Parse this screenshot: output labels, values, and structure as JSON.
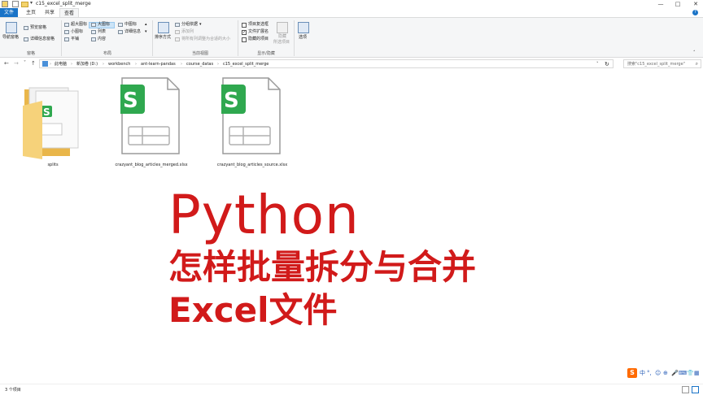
{
  "window": {
    "title": "c15_excel_split_merge",
    "qa_down": "▾",
    "min": "—",
    "max": "□",
    "close": "✕"
  },
  "tabs": [
    "文件",
    "主页",
    "共享",
    "查看"
  ],
  "ribbon": {
    "pane_group": {
      "label": "窗格",
      "nav_pane": "导航窗格",
      "preview_pane": "预览窗格",
      "details_pane": "详细信息窗格"
    },
    "layout_group": {
      "label": "布局",
      "items": [
        "超大图标",
        "大图标",
        "中图标",
        "小图标",
        "列表",
        "详细信息",
        "平铺",
        "内容"
      ],
      "selected": "大图标"
    },
    "current_view_group": {
      "label": "当前视图",
      "sort_by": "排序方式",
      "group_by": "分组依据",
      "add_columns": "添加列",
      "size_all_columns": "将所有列调整为合适的大小"
    },
    "show_hide_group": {
      "label": "显示/隐藏",
      "item_checkboxes": "项目复选框",
      "file_name_extensions": "文件扩展名",
      "hidden_items": "隐藏的项目",
      "hide_selected": "隐藏",
      "hide_selected_sub": "所选项目",
      "options": "选项",
      "checked": {
        "item_checkboxes": false,
        "file_name_extensions": true,
        "hidden_items": false
      }
    }
  },
  "nav": {
    "back": "←",
    "forward": "→",
    "recent": "˅",
    "up": "↑",
    "refresh": "↻",
    "dropdown": "˅",
    "breadcrumb": [
      "此电脑",
      "新加卷 (D:)",
      "workbench",
      "ant-learn-pandas",
      "course_datas",
      "c15_excel_split_merge"
    ],
    "search_placeholder": "搜索\"c15_excel_split_merge\""
  },
  "files": [
    {
      "name": "splits",
      "type": "folder"
    },
    {
      "name": "crazyant_blog_articles_merged.xlsx",
      "type": "xlsx"
    },
    {
      "name": "crazyant_blog_articles_source.xlsx",
      "type": "xlsx"
    }
  ],
  "overlay": {
    "line1": "Python",
    "line2": "怎样批量拆分与合并",
    "line3": "Excel文件",
    "color": "#d11a1a"
  },
  "status": {
    "item_count": "3 个项目"
  },
  "ime": {
    "logo": "S",
    "glyphs": [
      "中",
      "°,",
      "☺",
      "⊕",
      "🎤",
      "⌨",
      "👕",
      "▦"
    ]
  },
  "colors": {
    "accent": "#1a73c7",
    "xlsx_green": "#2fa84f",
    "folder_yellow": "#f6d27a"
  }
}
